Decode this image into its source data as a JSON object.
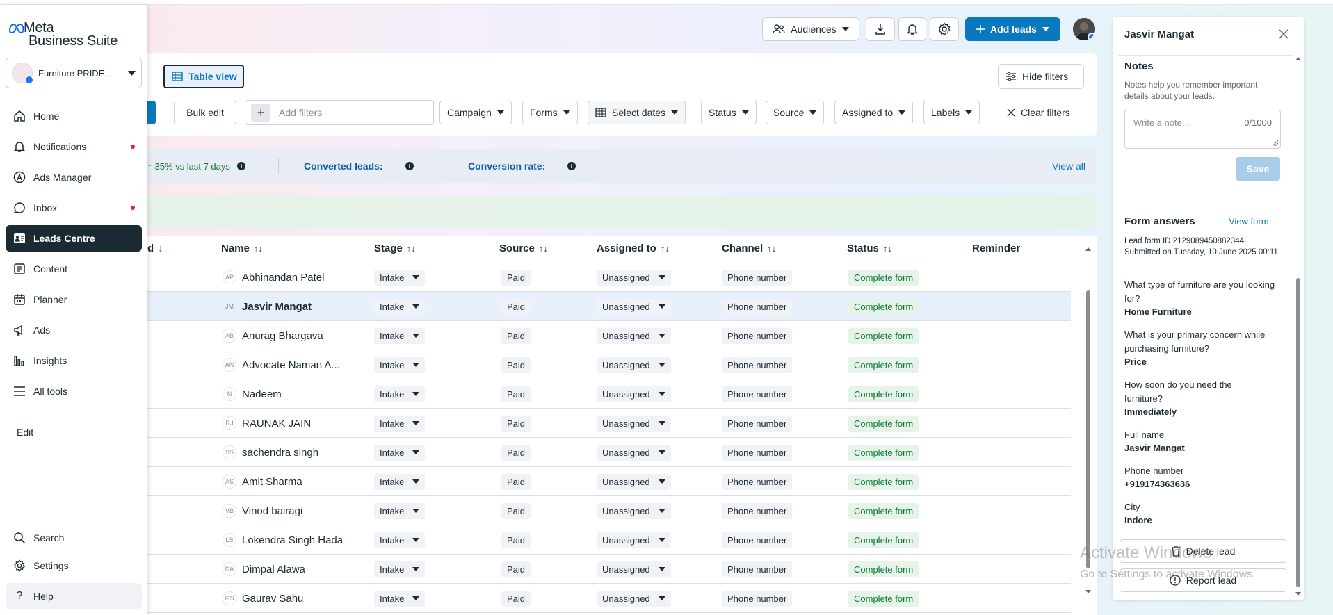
{
  "brand": {
    "line1": "Meta",
    "line2": "Business Suite"
  },
  "account": {
    "name": "Furniture PRIDE..."
  },
  "nav": {
    "items": [
      {
        "label": "Home",
        "icon": "home-icon"
      },
      {
        "label": "Notifications",
        "icon": "bell-icon",
        "dot": true
      },
      {
        "label": "Ads Manager",
        "icon": "ads-manager-icon"
      },
      {
        "label": "Inbox",
        "icon": "chat-bubble-icon",
        "dot": true
      },
      {
        "label": "Leads Centre",
        "icon": "leads-icon",
        "active": true
      },
      {
        "label": "Content",
        "icon": "content-icon"
      },
      {
        "label": "Planner",
        "icon": "calendar-icon"
      },
      {
        "label": "Ads",
        "icon": "megaphone-icon"
      },
      {
        "label": "Insights",
        "icon": "bar-chart-icon"
      },
      {
        "label": "All tools",
        "icon": "menu-icon"
      }
    ],
    "edit": "Edit",
    "search": "Search",
    "settings": "Settings",
    "help": "Help"
  },
  "header": {
    "audiences": "Audiences",
    "add_leads": "Add leads"
  },
  "toolbar": {
    "table_view": "Table view",
    "hide_filters": "Hide filters",
    "bulk_edit": "Bulk edit",
    "add_filters_placeholder": "Add filters",
    "filters": [
      "Campaign",
      "Forms",
      "Select dates",
      "Status",
      "Source",
      "Assigned to",
      "Labels"
    ],
    "clear_filters": "Clear filters"
  },
  "stats": {
    "change": "35% vs last 7 days",
    "converted_label": "Converted leads:",
    "converted_value": "—",
    "rate_label": "Conversion rate:",
    "rate_value": "—",
    "view_all": "View all"
  },
  "table": {
    "columns": {
      "created": "d",
      "name": "Name",
      "stage": "Stage",
      "source": "Source",
      "assigned": "Assigned to",
      "channel": "Channel",
      "status": "Status",
      "reminder": "Reminder"
    },
    "rows": [
      {
        "initials": "AP",
        "name": "Abhinandan Patel",
        "stage": "Intake",
        "source": "Paid",
        "assigned": "Unassigned",
        "channel": "Phone number",
        "status": "Complete form"
      },
      {
        "initials": "JM",
        "name": "Jasvir Mangat",
        "stage": "Intake",
        "source": "Paid",
        "assigned": "Unassigned",
        "channel": "Phone number",
        "status": "Complete form",
        "selected": true
      },
      {
        "initials": "AB",
        "name": "Anurag Bhargava",
        "stage": "Intake",
        "source": "Paid",
        "assigned": "Unassigned",
        "channel": "Phone number",
        "status": "Complete form"
      },
      {
        "initials": "AN",
        "name": "Advocate Naman A...",
        "stage": "Intake",
        "source": "Paid",
        "assigned": "Unassigned",
        "channel": "Phone number",
        "status": "Complete form"
      },
      {
        "initials": "N",
        "name": "Nadeem",
        "stage": "Intake",
        "source": "Paid",
        "assigned": "Unassigned",
        "channel": "Phone number",
        "status": "Complete form"
      },
      {
        "initials": "RJ",
        "name": "RAUNAK JAIN",
        "stage": "Intake",
        "source": "Paid",
        "assigned": "Unassigned",
        "channel": "Phone number",
        "status": "Complete form"
      },
      {
        "initials": "SS",
        "name": "sachendra singh",
        "stage": "Intake",
        "source": "Paid",
        "assigned": "Unassigned",
        "channel": "Phone number",
        "status": "Complete form"
      },
      {
        "initials": "AS",
        "name": "Amit Sharma",
        "stage": "Intake",
        "source": "Paid",
        "assigned": "Unassigned",
        "channel": "Phone number",
        "status": "Complete form"
      },
      {
        "initials": "VB",
        "name": "Vinod bairagi",
        "stage": "Intake",
        "source": "Paid",
        "assigned": "Unassigned",
        "channel": "Phone number",
        "status": "Complete form"
      },
      {
        "initials": "LS",
        "name": "Lokendra Singh Hada",
        "stage": "Intake",
        "source": "Paid",
        "assigned": "Unassigned",
        "channel": "Phone number",
        "status": "Complete form"
      },
      {
        "initials": "DA",
        "name": "Dimpal Alawa",
        "stage": "Intake",
        "source": "Paid",
        "assigned": "Unassigned",
        "channel": "Phone number",
        "status": "Complete form"
      },
      {
        "initials": "GS",
        "name": "Gaurav Sahu",
        "stage": "Intake",
        "source": "Paid",
        "assigned": "Unassigned",
        "channel": "Phone number",
        "status": "Complete form"
      }
    ]
  },
  "panel": {
    "title": "Jasvir Mangat",
    "notes_heading": "Notes",
    "notes_help": "Notes help you remember important details about your leads.",
    "note_placeholder": "Write a note...",
    "note_counter": "0/1000",
    "save": "Save",
    "form_answers": "Form answers",
    "view_form": "View form",
    "form_id": "Lead form ID 2129089450882344",
    "submitted": "Submitted on Tuesday, 10 June 2025 00:11.",
    "qa": [
      {
        "q": "What type of furniture are you looking for?",
        "a": "Home Furniture"
      },
      {
        "q": "What is your primary concern while purchasing furniture?",
        "a": "Price"
      },
      {
        "q": "How soon do you need the furniture?",
        "a": "Immediately"
      },
      {
        "q": "Full name",
        "a": "Jasvir Mangat"
      },
      {
        "q": "Phone number",
        "a": "+919174363636"
      },
      {
        "q": "City",
        "a": "Indore"
      }
    ],
    "delete_lead": "Delete lead",
    "report_lead": "Report lead"
  },
  "watermark": {
    "line1": "Activate Windows",
    "line2": "Go to Settings to activate Windows."
  }
}
